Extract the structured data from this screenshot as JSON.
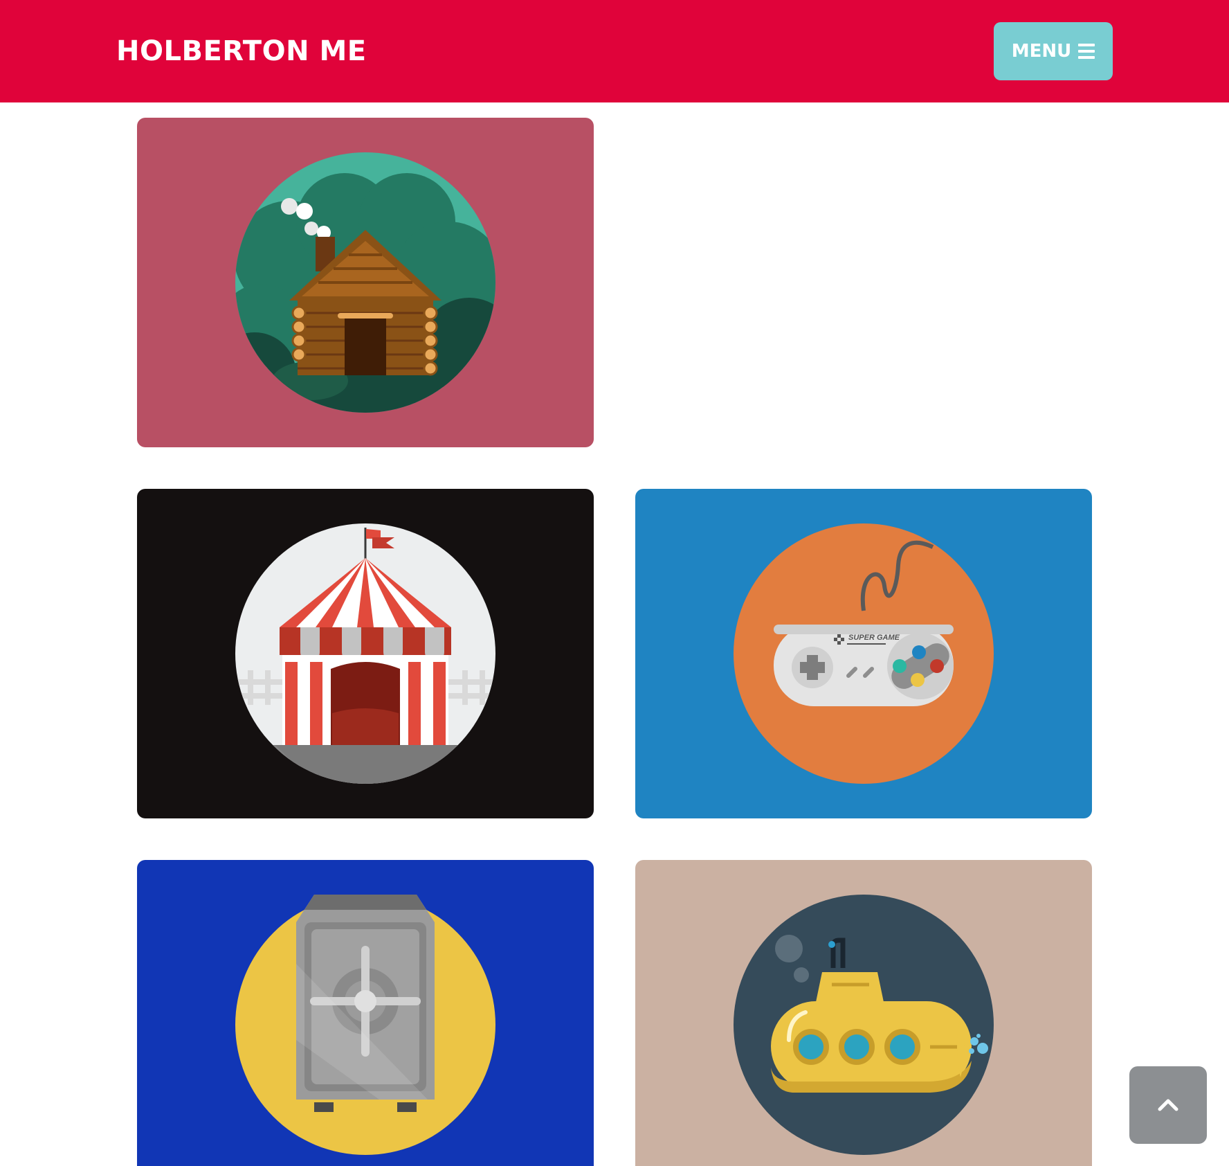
{
  "header": {
    "brand": "HOLBERTON ME",
    "menu_label": "MENU",
    "background": "#e0033a",
    "menu_color": "#79cdd2"
  },
  "portfolio": [
    {
      "name": "cabin",
      "icon": "log-cabin-icon",
      "background": "#b85064",
      "circle": "#46b39b"
    },
    {
      "name": "circus",
      "icon": "circus-tent-icon",
      "background": "#141010",
      "circle": "#eceeef"
    },
    {
      "name": "game",
      "icon": "game-controller-icon",
      "background": "#1f84c2",
      "circle": "#e27d3f",
      "controller_text": "SUPER GAME"
    },
    {
      "name": "safe",
      "icon": "safe-icon",
      "background": "#1136b5",
      "circle": "#ecc545"
    },
    {
      "name": "submarine",
      "icon": "submarine-icon",
      "background": "#cbb1a2",
      "circle": "#354b5a"
    }
  ],
  "scroll_top": {
    "icon": "chevron-up-icon",
    "color": "#8c8f92"
  }
}
